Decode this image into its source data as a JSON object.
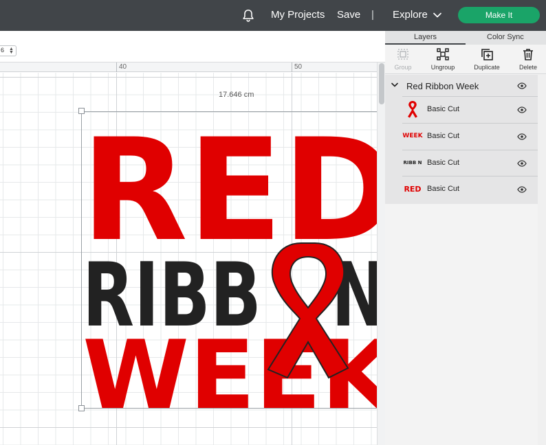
{
  "topbar": {
    "my_projects": "My Projects",
    "save": "Save",
    "separator": "|",
    "explore": "Explore",
    "make_it": "Make It",
    "accent_color": "#1aa468"
  },
  "toolbar": {
    "size_value": "6"
  },
  "ruler": {
    "label_40": "40",
    "label_50": "50"
  },
  "canvas": {
    "dimension_label": "17.646 cm",
    "artwork": {
      "line1": "RED",
      "line2_left": "RIBB",
      "line2_right": "N",
      "line3": "WEEK",
      "red": "#e00000",
      "black": "#222222"
    }
  },
  "panel": {
    "tabs": [
      {
        "label": "Layers",
        "active": true
      },
      {
        "label": "Color Sync",
        "active": false
      }
    ],
    "actions": [
      {
        "label": "Group",
        "icon": "group-icon",
        "enabled": false
      },
      {
        "label": "Ungroup",
        "icon": "ungroup-icon",
        "enabled": true
      },
      {
        "label": "Duplicate",
        "icon": "duplicate-icon",
        "enabled": true
      },
      {
        "label": "Delete",
        "icon": "trash-icon",
        "enabled": true
      }
    ],
    "group": {
      "title": "Red Ribbon Week",
      "layers": [
        {
          "label": "Basic Cut",
          "thumb": "ribbon"
        },
        {
          "label": "Basic Cut",
          "thumb": "WEEK"
        },
        {
          "label": "Basic Cut",
          "thumb": "RIBB N"
        },
        {
          "label": "Basic Cut",
          "thumb": "RED"
        }
      ]
    }
  }
}
